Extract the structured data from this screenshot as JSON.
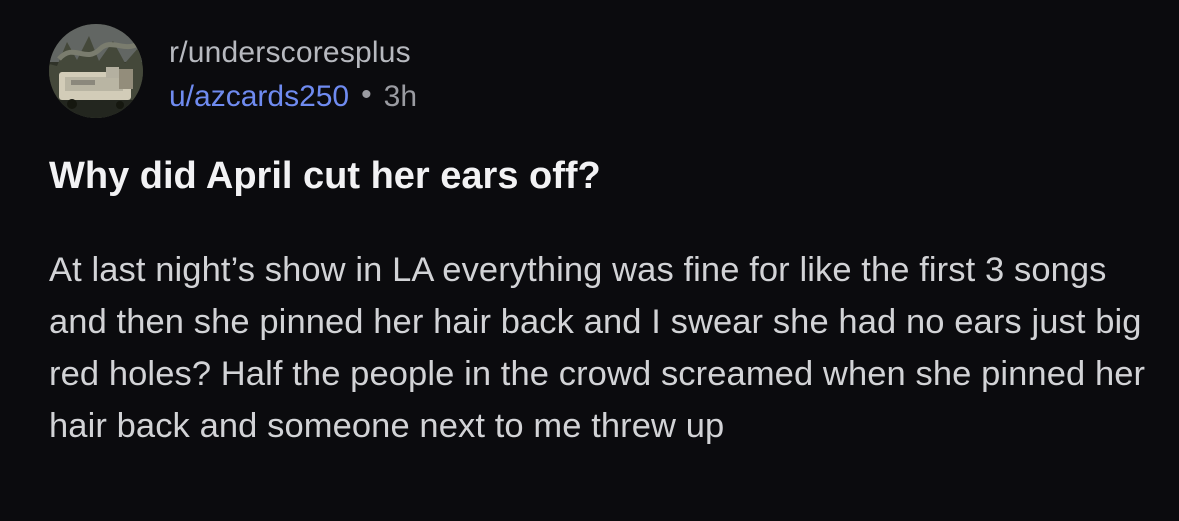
{
  "post": {
    "subreddit": "r/underscoresplus",
    "username": "u/azcards250",
    "separator": "•",
    "age": "3h",
    "title": "Why did April cut her ears off?",
    "body": "At last night’s show in LA everything was fine for like the first 3 songs and then she pinned her hair back and I swear she had no ears just big red holes? Half the people in the crowd screamed when she pinned her hair back and someone next to me threw up"
  },
  "colors": {
    "background": "#0b0b0e",
    "username": "#6f8bf0",
    "title": "#f2f2f4",
    "body": "#d2d3d6",
    "meta": "#9a9ba1"
  },
  "icons": {
    "avatar": "subreddit-avatar-photo"
  }
}
